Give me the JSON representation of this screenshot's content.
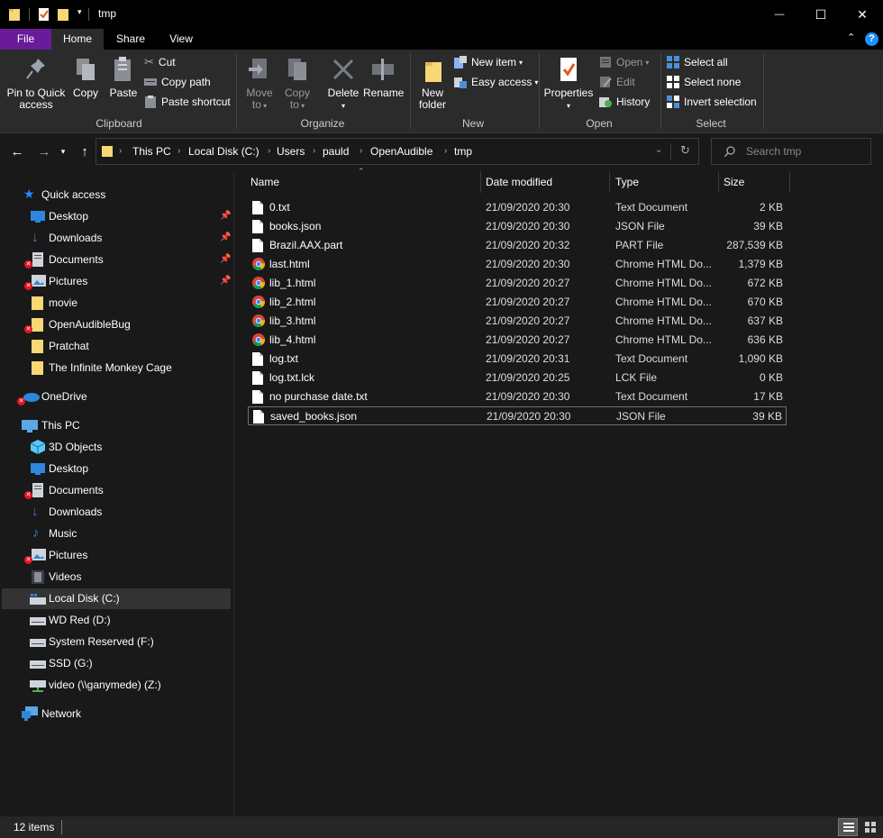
{
  "window": {
    "title": "tmp",
    "minimize_glyph": "—",
    "maximize_glyph": "☐",
    "close_glyph": "✕"
  },
  "tabs": [
    {
      "label": "File"
    },
    {
      "label": "Home"
    },
    {
      "label": "Share"
    },
    {
      "label": "View"
    }
  ],
  "ribbon": {
    "clipboard": {
      "label": "Clipboard",
      "pin_line1": "Pin to Quick",
      "pin_line2": "access",
      "copy": "Copy",
      "paste": "Paste",
      "cut": "Cut",
      "copy_path": "Copy path",
      "paste_shortcut": "Paste shortcut"
    },
    "organize": {
      "label": "Organize",
      "move_line1": "Move",
      "move_line2": "to",
      "copy_line1": "Copy",
      "copy_line2": "to",
      "delete": "Delete",
      "rename": "Rename"
    },
    "new": {
      "label": "New",
      "folder_line1": "New",
      "folder_line2": "folder",
      "new_item": "New item",
      "easy_access": "Easy access"
    },
    "open": {
      "label": "Open",
      "properties": "Properties",
      "open": "Open",
      "edit": "Edit",
      "history": "History"
    },
    "select": {
      "label": "Select",
      "select_all": "Select all",
      "select_none": "Select none",
      "invert": "Invert selection"
    }
  },
  "address": {
    "crumbs": [
      "This PC",
      "Local Disk (C:)",
      "Users",
      "pauld",
      "OpenAudible",
      "tmp"
    ],
    "search_placeholder": "Search tmp"
  },
  "nav": {
    "quick_access": "Quick access",
    "quick_items": [
      "Desktop",
      "Downloads",
      "Documents",
      "Pictures",
      "movie",
      "OpenAudibleBug",
      "Pratchat",
      "The Infinite Monkey Cage"
    ],
    "onedrive": "OneDrive",
    "this_pc": "This PC",
    "pc_items": [
      "3D Objects",
      "Desktop",
      "Documents",
      "Downloads",
      "Music",
      "Pictures",
      "Videos",
      "Local Disk (C:)",
      "WD Red (D:)",
      "System Reserved (F:)",
      "SSD (G:)",
      "video (\\\\ganymede) (Z:)"
    ],
    "network": "Network"
  },
  "columns": {
    "name": "Name",
    "date": "Date modified",
    "type": "Type",
    "size": "Size"
  },
  "files": [
    {
      "name": "0.txt",
      "date": "21/09/2020 20:30",
      "type": "Text Document",
      "size": "2 KB",
      "icon": "document-icon"
    },
    {
      "name": "books.json",
      "date": "21/09/2020 20:30",
      "type": "JSON File",
      "size": "39 KB",
      "icon": "document-icon"
    },
    {
      "name": "Brazil.AAX.part",
      "date": "21/09/2020 20:32",
      "type": "PART File",
      "size": "287,539 KB",
      "icon": "document-icon"
    },
    {
      "name": "last.html",
      "date": "21/09/2020 20:30",
      "type": "Chrome HTML Do...",
      "size": "1,379 KB",
      "icon": "chrome-icon"
    },
    {
      "name": "lib_1.html",
      "date": "21/09/2020 20:27",
      "type": "Chrome HTML Do...",
      "size": "672 KB",
      "icon": "chrome-icon"
    },
    {
      "name": "lib_2.html",
      "date": "21/09/2020 20:27",
      "type": "Chrome HTML Do...",
      "size": "670 KB",
      "icon": "chrome-icon"
    },
    {
      "name": "lib_3.html",
      "date": "21/09/2020 20:27",
      "type": "Chrome HTML Do...",
      "size": "637 KB",
      "icon": "chrome-icon"
    },
    {
      "name": "lib_4.html",
      "date": "21/09/2020 20:27",
      "type": "Chrome HTML Do...",
      "size": "636 KB",
      "icon": "chrome-icon"
    },
    {
      "name": "log.txt",
      "date": "21/09/2020 20:31",
      "type": "Text Document",
      "size": "1,090 KB",
      "icon": "document-icon"
    },
    {
      "name": "log.txt.lck",
      "date": "21/09/2020 20:25",
      "type": "LCK File",
      "size": "0 KB",
      "icon": "document-icon"
    },
    {
      "name": "no purchase date.txt",
      "date": "21/09/2020 20:30",
      "type": "Text Document",
      "size": "17 KB",
      "icon": "document-icon"
    },
    {
      "name": "saved_books.json",
      "date": "21/09/2020 20:30",
      "type": "JSON File",
      "size": "39 KB",
      "icon": "document-icon"
    }
  ],
  "status": {
    "count": "12 items"
  },
  "colors": {
    "file_tab": "#6a1b9a",
    "folder": "#f8d775",
    "accent_blue": "#1e90ff",
    "error": "#e81123"
  }
}
